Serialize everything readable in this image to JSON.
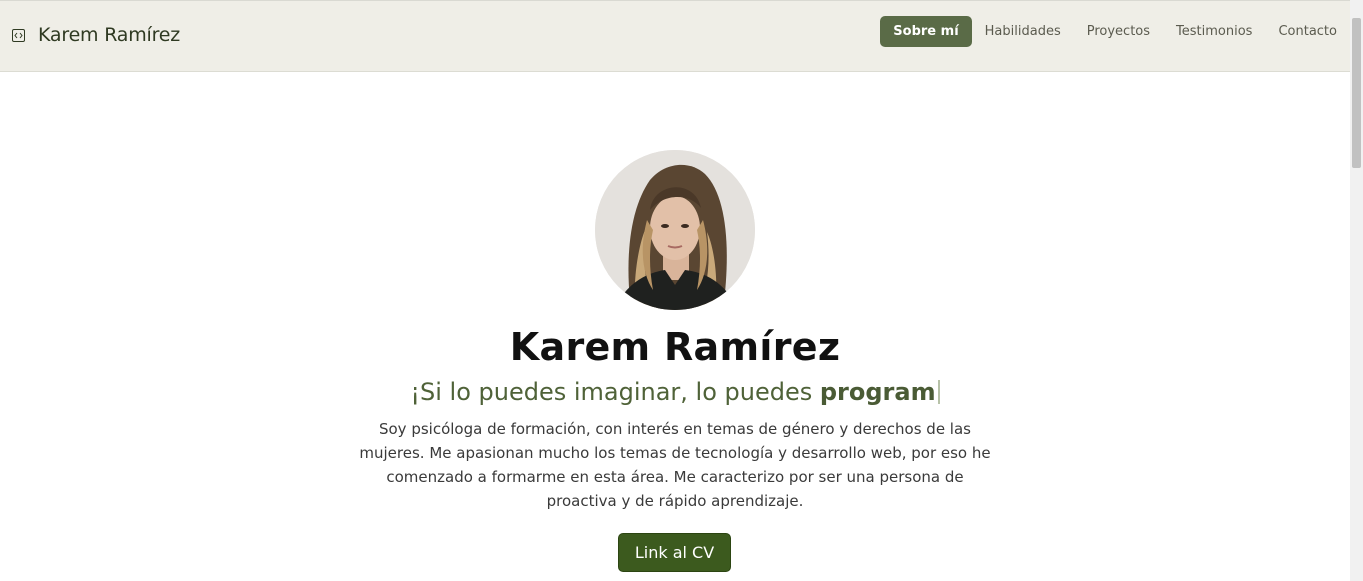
{
  "header": {
    "brand_name": "Karem Ramírez",
    "brand_icon": "code-icon",
    "nav": [
      {
        "label": "Sobre mí",
        "active": true
      },
      {
        "label": "Habilidades",
        "active": false
      },
      {
        "label": "Proyectos",
        "active": false
      },
      {
        "label": "Testimonios",
        "active": false
      },
      {
        "label": "Contacto",
        "active": false
      }
    ]
  },
  "hero": {
    "name": "Karem Ramírez",
    "tagline_regular": "¡Si lo puedes imaginar, lo puedes ",
    "tagline_bold": "program",
    "bio": "Soy psicóloga de formación, con interés en temas de género y derechos de las mujeres. Me apasionan mucho los temas de tecnología y desarrollo web, por eso he comenzado a formarme en esta área. Me caracterizo por ser una persona de proactiva y de rápido aprendizaje.",
    "cv_button": "Link al CV"
  },
  "colors": {
    "accent": "#5a6b47",
    "button": "#3c5a1e",
    "navbar_bg": "#efeee7",
    "tagline": "#4f6238"
  }
}
